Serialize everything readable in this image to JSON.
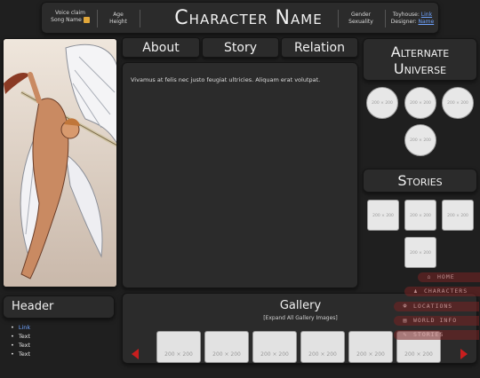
{
  "header": {
    "voice_claim_label": "Voice claim",
    "song_name_label": "Song Name",
    "age_label": "Age",
    "height_label": "Height",
    "character_name": "Character Name",
    "gender_label": "Gender",
    "sexuality_label": "Sexuality",
    "toyhouse_label": "Toyhouse:",
    "toyhouse_link": "Link",
    "designer_label": "Designer:",
    "designer_link": "Name"
  },
  "tabs": [
    {
      "label": "About"
    },
    {
      "label": "Story"
    },
    {
      "label": "Relation"
    }
  ],
  "content": {
    "text": "Vivamus at felis nec justo feugiat ultricies. Aliquam erat volutpat."
  },
  "alternate_universe": {
    "title": "Alternate Universe",
    "title_line1": "Alternate",
    "title_line2": "Universe",
    "thumbs": [
      "200 × 200",
      "200 × 200",
      "200 × 200",
      "200 × 200"
    ]
  },
  "stories": {
    "title": "Stories",
    "thumbs": [
      "200 × 200",
      "200 × 200",
      "200 × 200",
      "200 × 200"
    ]
  },
  "left_panel": {
    "title": "Header",
    "items": [
      "Link",
      "Text",
      "Text",
      "Text"
    ]
  },
  "gallery": {
    "title": "Gallery",
    "expand_label": "[Expand All Gallery Images]",
    "thumbs": [
      "200 × 200",
      "200 × 200",
      "200 × 200",
      "200 × 200",
      "200 × 200",
      "200 × 200"
    ]
  },
  "nav": [
    {
      "label": "HOME",
      "icon": "house-icon"
    },
    {
      "label": "CHARACTERS",
      "icon": "character-icon"
    },
    {
      "label": "LOCATIONS",
      "icon": "location-icon"
    },
    {
      "label": "WORLD INFO",
      "icon": "book-icon"
    },
    {
      "label": "STORIES",
      "icon": "pen-icon"
    }
  ],
  "colors": {
    "background": "#1f1f1f",
    "panel": "#2b2b2b",
    "link": "#6fa3ff",
    "arrow": "#c81e1e",
    "nav": "#782323"
  }
}
